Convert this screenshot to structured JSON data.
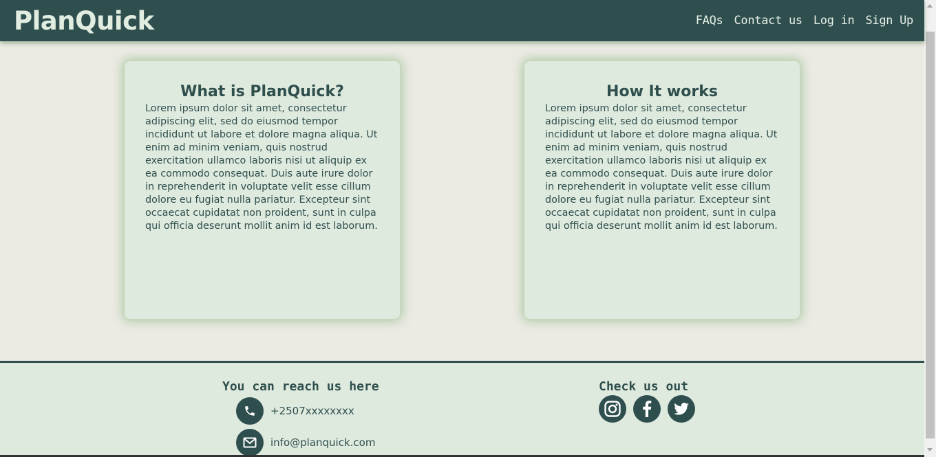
{
  "nav": {
    "logo": "PlanQuick",
    "links": [
      "FAQs",
      "Contact us",
      "Log in",
      "Sign Up"
    ]
  },
  "cards": [
    {
      "title": "What is PlanQuick?",
      "body": "Lorem ipsum dolor sit amet, consectetur adipiscing elit, sed do eiusmod tempor incididunt ut labore et dolore magna aliqua. Ut enim ad minim veniam, quis nostrud exercitation ullamco laboris nisi ut aliquip ex ea commodo consequat. Duis aute irure dolor in reprehenderit in voluptate velit esse cillum dolore eu fugiat nulla pariatur. Excepteur sint occaecat cupidatat non proident, sunt in culpa qui officia deserunt mollit anim id est laborum."
    },
    {
      "title": "How It works",
      "body": "Lorem ipsum dolor sit amet, consectetur adipiscing elit, sed do eiusmod tempor incididunt ut labore et dolore magna aliqua. Ut enim ad minim veniam, quis nostrud exercitation ullamco laboris nisi ut aliquip ex ea commodo consequat. Duis aute irure dolor in reprehenderit in voluptate velit esse cillum dolore eu fugiat nulla pariatur. Excepteur sint occaecat cupidatat non proident, sunt in culpa qui officia deserunt mollit anim id est laborum."
    }
  ],
  "footer": {
    "reach_heading": "You can reach us here",
    "phone": "+2507xxxxxxxx",
    "email": "info@planquick.com",
    "check_heading": "Check us out",
    "social_icons": [
      "instagram-icon",
      "facebook-icon",
      "twitter-icon"
    ]
  },
  "colors": {
    "navbar": "#2f4f4f",
    "background": "#ebeae3",
    "card": "#dfeadf",
    "text": "#2f4f4d"
  }
}
